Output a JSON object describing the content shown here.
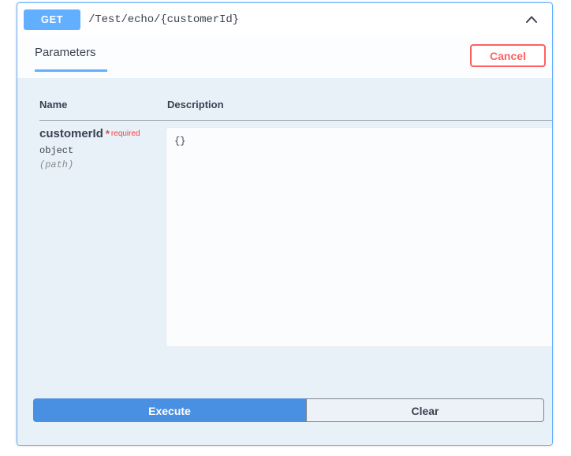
{
  "operation": {
    "method": "GET",
    "path": "/Test/echo/{customerId}",
    "collapse_icon": "chevron-up-icon"
  },
  "tabs": {
    "parameters_label": "Parameters",
    "cancel_label": "Cancel"
  },
  "parameters_table": {
    "columns": {
      "name": "Name",
      "description": "Description"
    },
    "rows": [
      {
        "name": "customerId",
        "required_star": "*",
        "required_label": "required",
        "type": "object",
        "in": "(path)",
        "value": "{}"
      }
    ]
  },
  "actions": {
    "execute_label": "Execute",
    "clear_label": "Clear"
  },
  "colors": {
    "get_method": "#61affe",
    "tab_underline": "#61affe",
    "cancel": "#ff6060",
    "required": "#f93e3e",
    "execute": "#4990e2",
    "card_border": "#61affe",
    "body_background": "#e8f0f8"
  }
}
